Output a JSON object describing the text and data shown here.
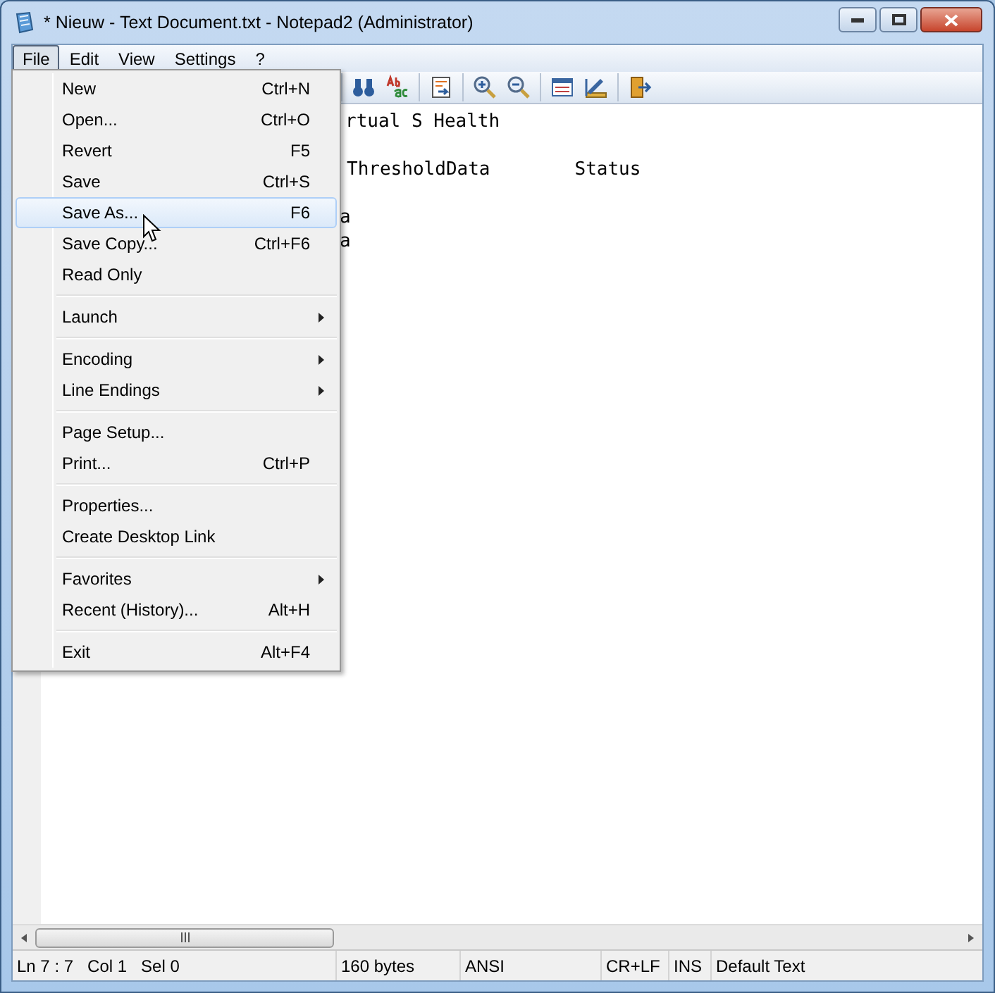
{
  "window": {
    "title": "* Nieuw - Text Document.txt - Notepad2 (Administrator)"
  },
  "menubar": [
    {
      "label": "File",
      "selected": true
    },
    {
      "label": "Edit",
      "selected": false
    },
    {
      "label": "View",
      "selected": false
    },
    {
      "label": "Settings",
      "selected": false
    },
    {
      "label": "?",
      "selected": false
    }
  ],
  "file_menu": [
    {
      "kind": "item",
      "label": "New",
      "shortcut": "Ctrl+N",
      "selected": false
    },
    {
      "kind": "item",
      "label": "Open...",
      "shortcut": "Ctrl+O",
      "selected": false
    },
    {
      "kind": "item",
      "label": "Revert",
      "shortcut": "F5",
      "selected": false
    },
    {
      "kind": "item",
      "label": "Save",
      "shortcut": "Ctrl+S",
      "selected": false
    },
    {
      "kind": "item",
      "label": "Save As...",
      "shortcut": "F6",
      "selected": true
    },
    {
      "kind": "item",
      "label": "Save Copy...",
      "shortcut": "Ctrl+F6",
      "selected": false
    },
    {
      "kind": "item",
      "label": "Read Only",
      "selected": false
    },
    {
      "kind": "separator"
    },
    {
      "kind": "submenu",
      "label": "Launch",
      "selected": false
    },
    {
      "kind": "separator"
    },
    {
      "kind": "submenu",
      "label": "Encoding",
      "selected": false
    },
    {
      "kind": "submenu",
      "label": "Line Endings",
      "selected": false
    },
    {
      "kind": "separator"
    },
    {
      "kind": "item",
      "label": "Page Setup...",
      "selected": false
    },
    {
      "kind": "item",
      "label": "Print...",
      "shortcut": "Ctrl+P",
      "selected": false
    },
    {
      "kind": "separator"
    },
    {
      "kind": "item",
      "label": "Properties...",
      "selected": false
    },
    {
      "kind": "item",
      "label": "Create Desktop Link",
      "selected": false
    },
    {
      "kind": "separator"
    },
    {
      "kind": "submenu",
      "label": "Favorites",
      "selected": false
    },
    {
      "kind": "item",
      "label": "Recent (History)...",
      "shortcut": "Alt+H",
      "selected": false
    },
    {
      "kind": "separator"
    },
    {
      "kind": "item",
      "label": "Exit",
      "shortcut": "Alt+F4",
      "selected": false
    }
  ],
  "editor": {
    "lines": [
      {
        "kind": "text",
        "segments": [
          "rtual S Health"
        ]
      },
      {
        "kind": "blank"
      },
      {
        "kind": "text",
        "segments": [
          "ThresholdData",
          "Status"
        ]
      },
      {
        "kind": "blank"
      },
      {
        "kind": "text",
        "segments": [
          "a"
        ]
      },
      {
        "kind": "text",
        "segments": [
          "a"
        ]
      }
    ]
  },
  "status_bar": [
    "Ln 7 : 7   Col 1   Sel 0",
    "160 bytes",
    "ANSI",
    "CR+LF",
    "INS",
    "Default Text"
  ]
}
